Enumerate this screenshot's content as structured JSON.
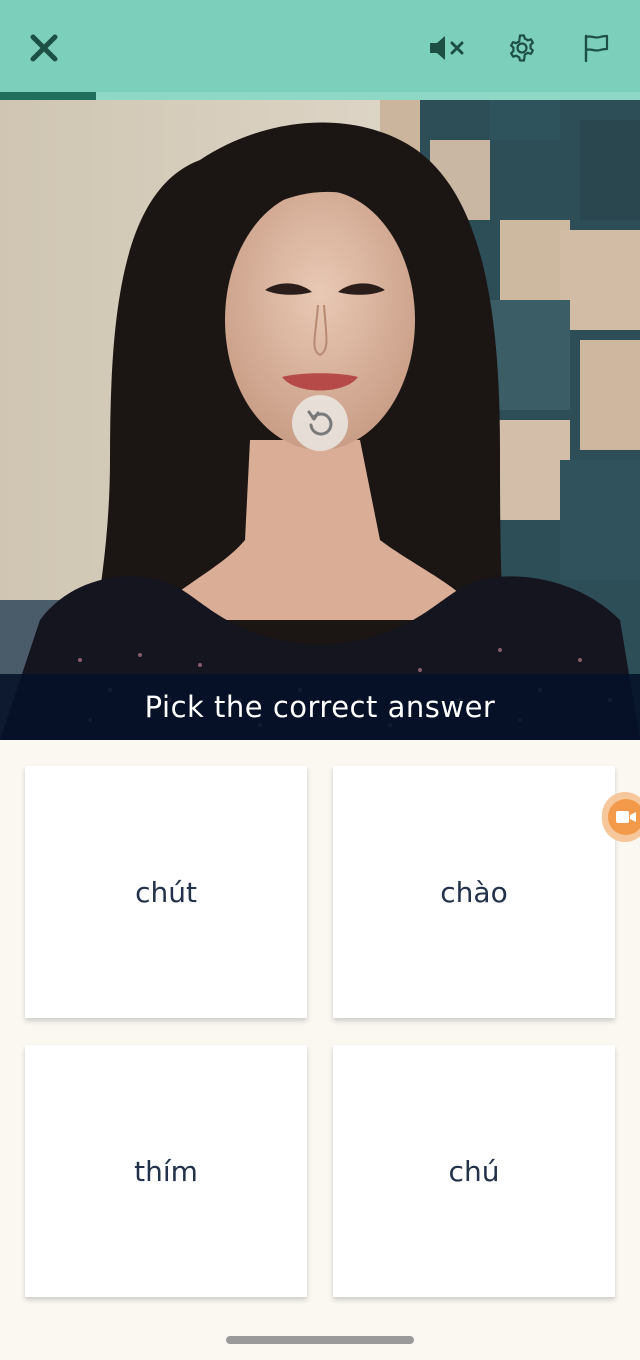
{
  "header": {
    "close_icon": "close-icon",
    "mute_icon": "speaker-muted-icon",
    "settings_icon": "gear-icon",
    "report_icon": "flag-icon",
    "progress_fraction": 0.15,
    "colors": {
      "bar": "#7ccfbb",
      "progress": "#1f6f5c",
      "icon": "#1d4f45"
    }
  },
  "video": {
    "replay_icon": "replay-icon",
    "caption": "Pick the correct answer"
  },
  "answers": [
    {
      "label": "chút"
    },
    {
      "label": "chào"
    },
    {
      "label": "thím"
    },
    {
      "label": "chú"
    }
  ],
  "side_tab": {
    "icon": "video-camera-icon",
    "color": "#f39a4a"
  }
}
